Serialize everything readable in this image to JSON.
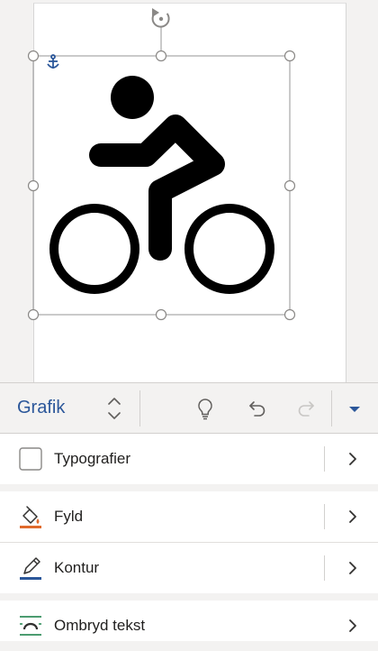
{
  "ribbon": {
    "tab_title": "Grafik",
    "switch_icon": "chevron-up-down-icon",
    "buttons": [
      "lightbulb-icon",
      "undo-icon",
      "redo-icon",
      "expand-caret-icon"
    ]
  },
  "canvas": {
    "graphic_icon": "bicycle-rider-icon",
    "anchor_icon": "anchor-icon",
    "rotate_icon": "rotate-handle-icon"
  },
  "panel": {
    "items": [
      {
        "label": "Typografier",
        "icon": "styles-checkbox-icon"
      },
      {
        "label": "Fyld",
        "icon": "paint-bucket-icon"
      },
      {
        "label": "Kontur",
        "icon": "pencil-outline-icon"
      },
      {
        "label": "Ombryd tekst",
        "icon": "wrap-text-icon"
      }
    ]
  },
  "colors": {
    "accent": "#2b579a",
    "fill_accent": "#e06a2c",
    "outline_accent": "#2b579a",
    "wrap_accent": "#107c41"
  }
}
